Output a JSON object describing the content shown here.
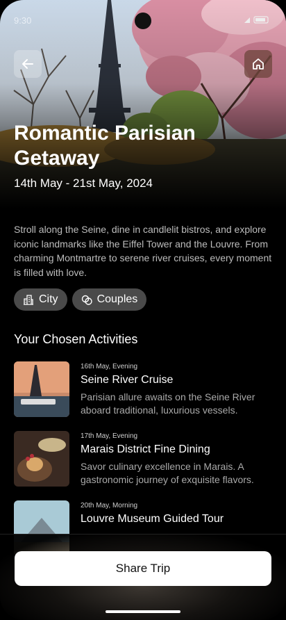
{
  "status": {
    "time": "9:30"
  },
  "trip": {
    "title": "Romantic Parisian Getaway",
    "dates": "14th May - 21st May, 2024",
    "description": "Stroll along the Seine, dine in candlelit bistros, and explore iconic landmarks like the Eiffel Tower and the Louvre. From charming Montmartre to serene river cruises, every moment is filled with love.",
    "tags": [
      {
        "label": "City",
        "icon": "city-buildings-icon"
      },
      {
        "label": "Couples",
        "icon": "couple-rings-icon"
      }
    ]
  },
  "activities": {
    "heading": "Your Chosen Activities",
    "items": [
      {
        "meta": "16th May, Evening",
        "title": "Seine River Cruise",
        "description": "Parisian allure awaits on the Seine River aboard traditional, luxurious vessels."
      },
      {
        "meta": "17th May, Evening",
        "title": "Marais District Fine Dining",
        "description": "Savor culinary excellence in Marais. A gastronomic journey of exquisite flavors."
      },
      {
        "meta": "20th May, Morning",
        "title": "Louvre Museum Guided Tour",
        "description": ""
      }
    ]
  },
  "actions": {
    "share_label": "Share Trip"
  },
  "icons": {
    "back": "arrow-left-icon",
    "home": "home-icon"
  },
  "colors": {
    "background": "#000000",
    "chip": "#4a4a4a",
    "share_button": "#ffffff"
  }
}
